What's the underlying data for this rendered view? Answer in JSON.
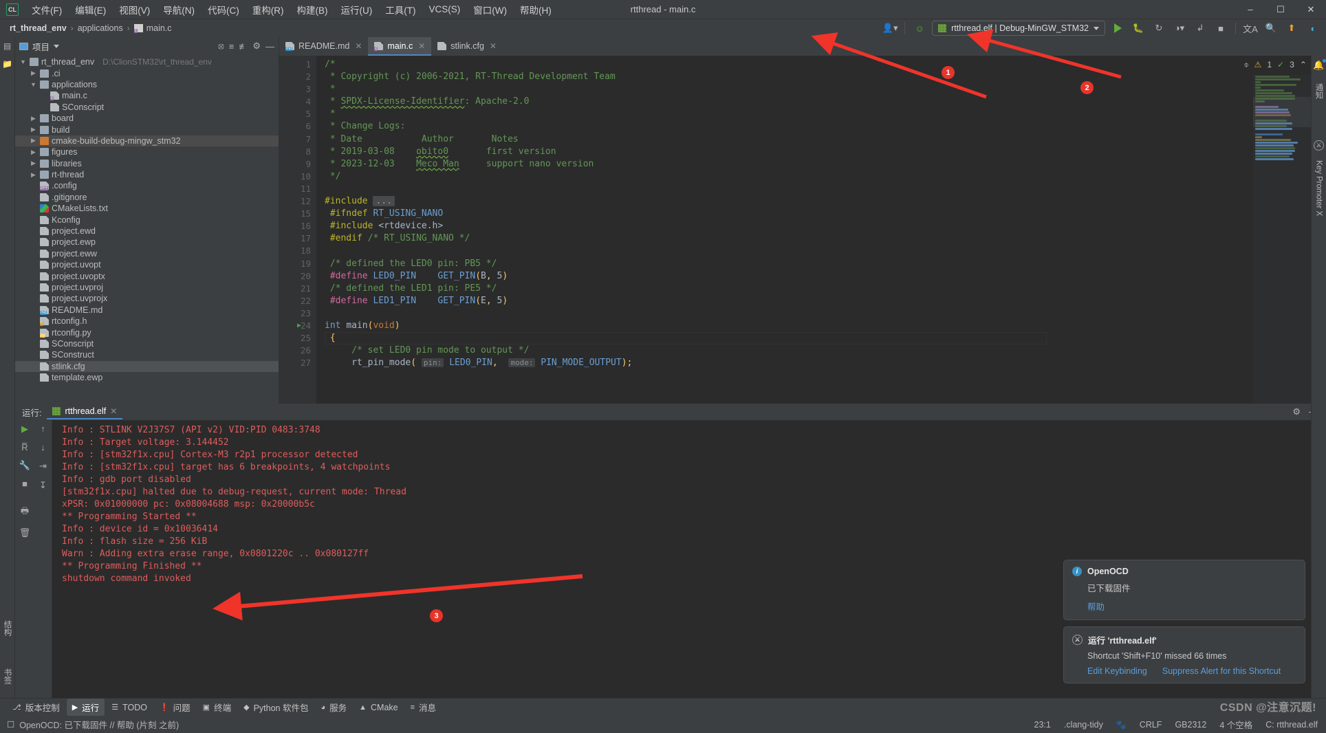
{
  "window": {
    "title": "rtthread - main.c",
    "logo": "CL",
    "controls": {
      "minimize": "–",
      "maximize": "☐",
      "close": "✕"
    }
  },
  "menu": [
    {
      "label": "文件(F)"
    },
    {
      "label": "编辑(E)"
    },
    {
      "label": "视图(V)"
    },
    {
      "label": "导航(N)"
    },
    {
      "label": "代码(C)"
    },
    {
      "label": "重构(R)"
    },
    {
      "label": "构建(B)"
    },
    {
      "label": "运行(U)"
    },
    {
      "label": "工具(T)"
    },
    {
      "label": "VCS(S)"
    },
    {
      "label": "窗口(W)"
    },
    {
      "label": "帮助(H)"
    }
  ],
  "breadcrumb": [
    {
      "label": "rt_thread_env",
      "icon": "none"
    },
    {
      "label": "applications",
      "icon": "none"
    },
    {
      "label": "main.c",
      "icon": "c-file-icon"
    }
  ],
  "toolbar": {
    "run_config": "rtthread.elf | Debug-MinGW_STM32",
    "icons": [
      {
        "name": "user-avatar-icon",
        "glyph": "👤"
      },
      {
        "name": "build-hammer-icon",
        "glyph": "⚒"
      },
      {
        "name": "run-icon",
        "glyph": "▶"
      },
      {
        "name": "debug-icon",
        "glyph": "🐞"
      },
      {
        "name": "run-with-coverage-icon",
        "glyph": "↺"
      },
      {
        "name": "profile-icon",
        "glyph": "◔"
      },
      {
        "name": "attach-process-icon",
        "glyph": "↱"
      },
      {
        "name": "stop-icon",
        "glyph": "■"
      },
      {
        "name": "translate-icon",
        "glyph": "文A"
      },
      {
        "name": "search-everywhere-icon",
        "glyph": "🔍"
      },
      {
        "name": "update-icon",
        "glyph": "↑"
      },
      {
        "name": "ai-assistant-icon",
        "glyph": "◖"
      }
    ]
  },
  "left_strip": [
    {
      "name": "project-tool-icon",
      "label": "项目"
    },
    {
      "name": "commit-tool-icon",
      "label": ""
    },
    {
      "name": "structure-tool-icon",
      "label": "结构"
    },
    {
      "name": "bookmarks-tool-icon",
      "label": "书签"
    }
  ],
  "project_panel": {
    "title": "项目",
    "header_icons": [
      {
        "name": "select-opened-file-icon",
        "glyph": "⊕"
      },
      {
        "name": "expand-all-icon",
        "glyph": "≡"
      },
      {
        "name": "collapse-all-icon",
        "glyph": "≢"
      },
      {
        "name": "settings-gear-icon",
        "glyph": "⚙"
      },
      {
        "name": "hide-panel-icon",
        "glyph": "—"
      }
    ],
    "tree": [
      {
        "label": "rt_thread_env",
        "path": "D:\\ClionSTM32\\rt_thread_env",
        "indent": 0,
        "arrow": "down",
        "icon": "folder",
        "badge": ""
      },
      {
        "label": ".ci",
        "path": "",
        "indent": 1,
        "arrow": "right",
        "icon": "folder",
        "badge": ""
      },
      {
        "label": "applications",
        "path": "",
        "indent": 1,
        "arrow": "down",
        "icon": "folder",
        "badge": ""
      },
      {
        "label": "main.c",
        "path": "",
        "indent": 2,
        "arrow": "none",
        "icon": "file",
        "badge": "c"
      },
      {
        "label": "SConscript",
        "path": "",
        "indent": 2,
        "arrow": "none",
        "icon": "file",
        "badge": ""
      },
      {
        "label": "board",
        "path": "",
        "indent": 1,
        "arrow": "right",
        "icon": "folder",
        "badge": ""
      },
      {
        "label": "build",
        "path": "",
        "indent": 1,
        "arrow": "right",
        "icon": "folder",
        "badge": ""
      },
      {
        "label": "cmake-build-debug-mingw_stm32",
        "path": "",
        "indent": 1,
        "arrow": "right",
        "icon": "folder-orange",
        "badge": "",
        "selected": true
      },
      {
        "label": "figures",
        "path": "",
        "indent": 1,
        "arrow": "right",
        "icon": "folder",
        "badge": ""
      },
      {
        "label": "libraries",
        "path": "",
        "indent": 1,
        "arrow": "right",
        "icon": "folder",
        "badge": ""
      },
      {
        "label": "rt-thread",
        "path": "",
        "indent": 1,
        "arrow": "right",
        "icon": "folder",
        "badge": ""
      },
      {
        "label": ".config",
        "path": "",
        "indent": 1,
        "arrow": "none",
        "icon": "file",
        "badge": "c++"
      },
      {
        "label": ".gitignore",
        "path": "",
        "indent": 1,
        "arrow": "none",
        "icon": "file",
        "badge": ""
      },
      {
        "label": "CMakeLists.txt",
        "path": "",
        "indent": 1,
        "arrow": "none",
        "icon": "cmake",
        "badge": ""
      },
      {
        "label": "Kconfig",
        "path": "",
        "indent": 1,
        "arrow": "none",
        "icon": "file",
        "badge": ""
      },
      {
        "label": "project.ewd",
        "path": "",
        "indent": 1,
        "arrow": "none",
        "icon": "file",
        "badge": ""
      },
      {
        "label": "project.ewp",
        "path": "",
        "indent": 1,
        "arrow": "none",
        "icon": "file",
        "badge": ""
      },
      {
        "label": "project.eww",
        "path": "",
        "indent": 1,
        "arrow": "none",
        "icon": "file",
        "badge": ""
      },
      {
        "label": "project.uvopt",
        "path": "",
        "indent": 1,
        "arrow": "none",
        "icon": "file",
        "badge": ""
      },
      {
        "label": "project.uvoptx",
        "path": "",
        "indent": 1,
        "arrow": "none",
        "icon": "file",
        "badge": ""
      },
      {
        "label": "project.uvproj",
        "path": "",
        "indent": 1,
        "arrow": "none",
        "icon": "file",
        "badge": ""
      },
      {
        "label": "project.uvprojx",
        "path": "",
        "indent": 1,
        "arrow": "none",
        "icon": "file",
        "badge": ""
      },
      {
        "label": "README.md",
        "path": "",
        "indent": 1,
        "arrow": "none",
        "icon": "file",
        "badge": "md"
      },
      {
        "label": "rtconfig.h",
        "path": "",
        "indent": 1,
        "arrow": "none",
        "icon": "file",
        "badge": "h"
      },
      {
        "label": "rtconfig.py",
        "path": "",
        "indent": 1,
        "arrow": "none",
        "icon": "file",
        "badge": "py"
      },
      {
        "label": "SConscript",
        "path": "",
        "indent": 1,
        "arrow": "none",
        "icon": "file",
        "badge": ""
      },
      {
        "label": "SConstruct",
        "path": "",
        "indent": 1,
        "arrow": "none",
        "icon": "file",
        "badge": ""
      },
      {
        "label": "stlink.cfg",
        "path": "",
        "indent": 1,
        "arrow": "none",
        "icon": "file",
        "badge": "",
        "selected": true
      },
      {
        "label": "template.ewp",
        "path": "",
        "indent": 1,
        "arrow": "none",
        "icon": "file",
        "badge": ""
      }
    ]
  },
  "editor": {
    "tabs": [
      {
        "label": "README.md",
        "badge": "md",
        "active": false
      },
      {
        "label": "main.c",
        "badge": "c",
        "active": true
      },
      {
        "label": "stlink.cfg",
        "badge": "",
        "active": false
      }
    ],
    "inspector": {
      "eye_off_icon": "⌽",
      "warning_count": "1",
      "ok_count": "3",
      "up_icon": "⌃",
      "down_icon": "⌄"
    },
    "line_numbers": [
      "1",
      "2",
      "3",
      "4",
      "5",
      "6",
      "7",
      "8",
      "9",
      "10",
      "11",
      "12",
      "15",
      "16",
      "17",
      "18",
      "19",
      "20",
      "21",
      "22",
      "23",
      "24",
      "25",
      "26",
      "27"
    ],
    "lines": [
      {
        "n": "1",
        "html": "<span class='cm'>/*</span>"
      },
      {
        "n": "2",
        "html": " <span class='cm'>* Copyright (c) 2006-2021, RT-Thread Development Team</span>"
      },
      {
        "n": "3",
        "html": " <span class='cm'>*</span>"
      },
      {
        "n": "4",
        "html": " <span class='cm'>* </span><span class='cm wavy'>SPDX-License-Identifier</span><span class='cm'>: Apache-2.0</span>"
      },
      {
        "n": "5",
        "html": " <span class='cm'>*</span>"
      },
      {
        "n": "6",
        "html": " <span class='cm'>* Change Logs:</span>"
      },
      {
        "n": "7",
        "html": " <span class='cm'>* Date           Author       Notes</span>"
      },
      {
        "n": "8",
        "html": " <span class='cm'>* 2019-03-08    </span><span class='cm wavy'>obito0</span><span class='cm'>       first version</span>"
      },
      {
        "n": "9",
        "html": " <span class='cm'>* 2023-12-03    </span><span class='cm wavy'>Meco Man</span><span class='cm'>     support nano version</span>"
      },
      {
        "n": "10",
        "html": " <span class='cm'>*/</span>"
      },
      {
        "n": "11",
        "html": ""
      },
      {
        "n": "12",
        "html": "<span class='pp'>#include</span> <span class='ellipsis'>...</span>"
      },
      {
        "n": "15",
        "html": " <span class='pp'>#ifndef</span> <span class='blue'>RT_USING_NANO</span>"
      },
      {
        "n": "16",
        "html": " <span class='pp'>#include</span> <span class='id'>&lt;rtdevice.h&gt;</span>"
      },
      {
        "n": "17",
        "html": " <span class='pp'>#endif</span> <span class='cm'>/* RT_USING_NANO */</span>"
      },
      {
        "n": "18",
        "html": ""
      },
      {
        "n": "19",
        "html": " <span class='cm'>/* defined the LED0 pin: PB5 */</span>"
      },
      {
        "n": "20",
        "html": " <span class='pink'>#define</span> <span class='blue'>LED0_PIN</span>    <span class='blue'>GET_PIN</span><span class='yel'>(</span><span class='id'>B</span><span class='yel'>,</span> <span class='id'>5</span><span class='yel'>)</span>"
      },
      {
        "n": "21",
        "html": " <span class='cm'>/* defined the LED1 pin: PE5 */</span>"
      },
      {
        "n": "22",
        "html": " <span class='pink'>#define</span> <span class='blue'>LED1_PIN</span>    <span class='blue'>GET_PIN</span><span class='yel'>(</span><span class='id'>E</span><span class='yel'>,</span> <span class='id'>5</span><span class='yel'>)</span>"
      },
      {
        "n": "23",
        "html": ""
      },
      {
        "n": "24",
        "html": "<span class='blue'>int</span> <span class='id'>main</span><span class='yel'>(</span><span class='kw'>void</span><span class='yel'>)</span>"
      },
      {
        "n": "25",
        "html": " <span class='yel'>{</span>"
      },
      {
        "n": "26",
        "html": "     <span class='cm'>/* set LED0 pin mode to output */</span>"
      },
      {
        "n": "27",
        "html": "     <span class='id'>rt_pin_mode</span><span class='yel'>(</span> <span class='hintchip'>pin:</span> <span class='blue'>LED0_PIN</span><span class='yel'>,</span>  <span class='hintchip'>mode:</span> <span class='blue'>PIN_MODE_OUTPUT</span><span class='yel'>);</span>"
      }
    ]
  },
  "right_strip": [
    {
      "name": "notifications-icon",
      "label": "通知"
    },
    {
      "name": "key-promoter-icon",
      "label": "Key Promoter X"
    }
  ],
  "run_panel": {
    "label": "运行:",
    "tab": "rtthread.elf",
    "header_icons": [
      {
        "name": "settings-gear-icon",
        "glyph": "⚙"
      },
      {
        "name": "hide-panel-icon",
        "glyph": "—"
      }
    ],
    "actions": [
      {
        "name": "rerun-button",
        "glyph": "▶"
      },
      {
        "name": "rerun-failed-button",
        "glyph": "R̄"
      },
      {
        "name": "configure-button",
        "glyph": "🔧"
      },
      {
        "name": "stop-button",
        "glyph": "■"
      },
      {
        "name": "print-button",
        "glyph": "🖨"
      },
      {
        "name": "clear-all-button",
        "glyph": "🗑"
      }
    ],
    "actions2": [
      {
        "name": "scroll-up-button",
        "glyph": "↑"
      },
      {
        "name": "scroll-down-button",
        "glyph": "↓"
      },
      {
        "name": "soft-wrap-button",
        "glyph": "↵"
      },
      {
        "name": "scroll-to-end-button",
        "glyph": "↧"
      }
    ],
    "console_lines": [
      "Info : STLINK V2J37S7 (API v2) VID:PID 0483:3748",
      "Info : Target voltage: 3.144452",
      "Info : [stm32f1x.cpu] Cortex-M3 r2p1 processor detected",
      "Info : [stm32f1x.cpu] target has 6 breakpoints, 4 watchpoints",
      "Info : gdb port disabled",
      "[stm32f1x.cpu] halted due to debug-request, current mode: Thread",
      "xPSR: 0x01000000 pc: 0x08004688 msp: 0x20000b5c",
      "** Programming Started **",
      "Info : device id = 0x10036414",
      "Info : flash size = 256 KiB",
      "Warn : Adding extra erase range, 0x0801220c .. 0x080127ff",
      "** Programming Finished **",
      "shutdown command invoked"
    ]
  },
  "notifications": [
    {
      "icon": "info-icon",
      "title": "OpenOCD",
      "message": "已下载固件",
      "links": [
        "帮助"
      ]
    },
    {
      "icon": "key-promoter-icon",
      "title": "运行 'rtthread.elf'",
      "message": "Shortcut 'Shift+F10' missed 66 times",
      "links": [
        "Edit Keybinding",
        "Suppress Alert for this Shortcut"
      ]
    }
  ],
  "tool_windows": [
    {
      "label": "版本控制",
      "icon": "branch-icon",
      "active": false
    },
    {
      "label": "运行",
      "icon": "run-icon",
      "active": true
    },
    {
      "label": "TODO",
      "icon": "list-icon",
      "active": false
    },
    {
      "label": "问题",
      "icon": "warning-icon",
      "active": false
    },
    {
      "label": "终端",
      "icon": "terminal-icon",
      "active": false
    },
    {
      "label": "Python 软件包",
      "icon": "python-icon",
      "active": false
    },
    {
      "label": "服务",
      "icon": "services-icon",
      "active": false
    },
    {
      "label": "CMake",
      "icon": "cmake-icon",
      "active": false
    },
    {
      "label": "消息",
      "icon": "messages-icon",
      "active": false
    }
  ],
  "status_bar": {
    "message": "OpenOCD: 已下载固件 // 帮助 (片刻 之前)",
    "caret_position": "23:1",
    "inspection": ".clang-tidy",
    "line_separator": "CRLF",
    "encoding": "GB2312",
    "indent": "4 个空格",
    "run_target": "C: rtthread.elf",
    "watermark": "CSDN @注意沉题!"
  },
  "annotations": [
    {
      "label": "1"
    },
    {
      "label": "2"
    },
    {
      "label": "3"
    }
  ],
  "colors": {
    "accent_blue": "#4a88c7",
    "panel_bg": "#3c3f41",
    "editor_bg": "#2b2b2b",
    "console_red": "#e05c5c",
    "annotation_red": "#e8342a",
    "comment_green": "#629755"
  }
}
